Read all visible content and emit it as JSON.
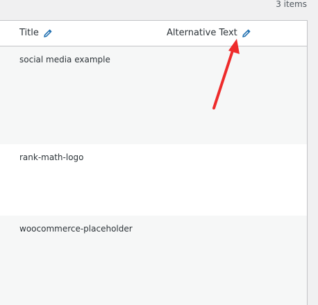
{
  "header": {
    "items_count": "3 items"
  },
  "table": {
    "columns": [
      {
        "label": "Title",
        "icon": "pencil-icon"
      },
      {
        "label": "Alternative Text",
        "icon": "pencil-icon"
      }
    ],
    "rows": [
      {
        "title": "social media example",
        "alt_text": ""
      },
      {
        "title": "rank-math-logo",
        "alt_text": ""
      },
      {
        "title": "woocommerce-placeholder",
        "alt_text": ""
      }
    ]
  },
  "colors": {
    "accent": "#2271b1",
    "annotation": "#ee2b2b",
    "row_alt": "#f6f7f7",
    "border": "#c3c4c7"
  }
}
